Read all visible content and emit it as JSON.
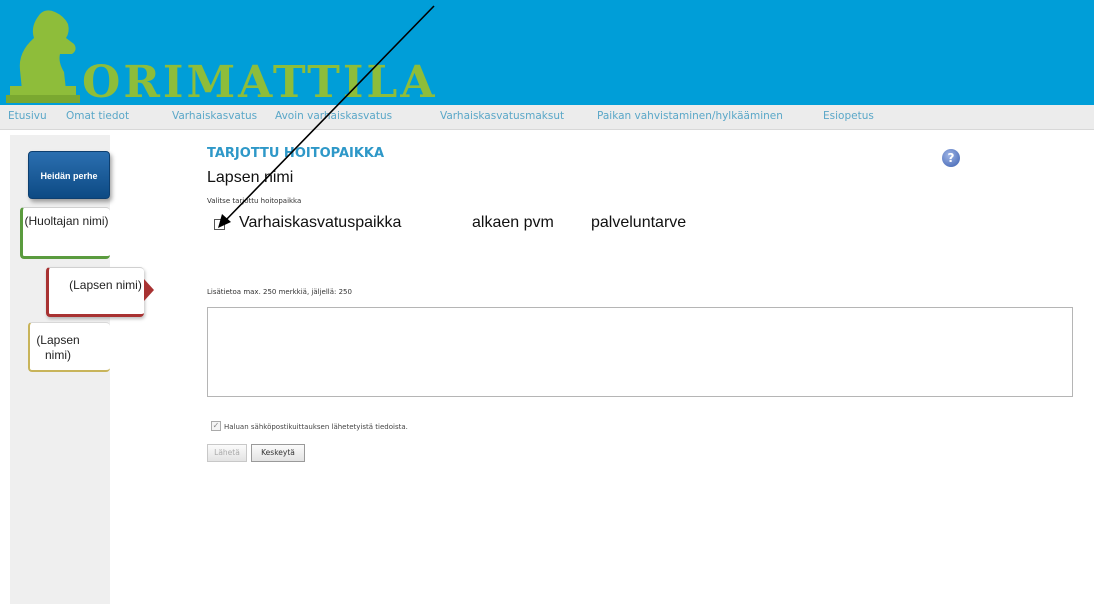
{
  "brand": {
    "logo_text": "ORIMATTILA",
    "colors": {
      "banner": "#009ed8",
      "logo": "#8ebd3a",
      "link": "#5aa7c8",
      "title": "#2e98c8"
    }
  },
  "nav": {
    "items": [
      "Etusivu",
      "Omat tiedot",
      "Varhaiskasvatus",
      "Avoin varhaiskasvatus",
      "Varhaiskasvatusmaksut",
      "Paikan vahvistaminen/hylkääminen",
      "Esiopetus"
    ]
  },
  "sidebar": {
    "family_tab": "Heidän perhe",
    "guardian_tab": "(Huoltajan nimi)",
    "child_tab_active": "(Lapsen nimi)",
    "child_tab_2": "(Lapsen nimi)"
  },
  "main": {
    "section_title": "TARJOTTU HOITOPAIKKA",
    "child_name": "Lapsen nimi",
    "select_label": "Valitse tarjottu hoitopaikka",
    "offer": {
      "place": "Varhaiskasvatuspaikka",
      "start": "alkaen pvm",
      "need": "palveluntarve",
      "checked": false
    },
    "notes_label": "Lisätietoa max. 250 merkkiä, jäljellä: 250",
    "notes_value": "",
    "email_confirm_label": "Haluan sähköpostikuittauksen lähetetyistä tiedoista.",
    "email_confirm_checked": true,
    "send_button": "Lähetä",
    "cancel_button": "Keskeytä",
    "help_icon": "?"
  },
  "icons": [
    "knight-logo-icon",
    "help-icon",
    "annotation-arrow-icon"
  ]
}
